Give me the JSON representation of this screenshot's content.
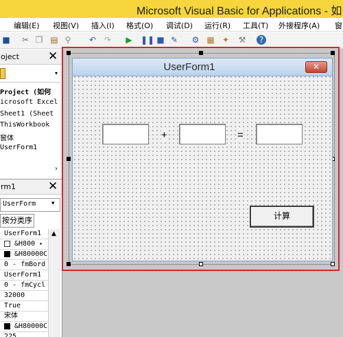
{
  "window": {
    "title": "Microsoft Visual Basic for Applications - 如"
  },
  "menu": [
    "编辑(E)",
    "视图(V)",
    "插入(I)",
    "格式(O)",
    "调试(D)",
    "运行(R)",
    "工具(T)",
    "外接程序(A)",
    "窗"
  ],
  "project_pane": {
    "label": "oject",
    "tree": [
      "Project (如何",
      "icrosoft Excel",
      "Sheet1 (Sheet",
      "ThisWorkbook",
      "窗体",
      "UserForm1"
    ]
  },
  "properties_pane": {
    "label": "rm1",
    "object_select": "UserForm",
    "tab": "按分类序",
    "values": [
      "UserForm1",
      "&H800",
      "&H80000C",
      "0 - fmBord",
      "UserForm1",
      "0 - fmCycl",
      "32000",
      "True",
      "宋体",
      "&H80000C",
      "225"
    ]
  },
  "userform": {
    "caption": "UserForm1",
    "close_glyph": "✕",
    "plus": "+",
    "equals": "=",
    "calc_button": "计算"
  },
  "colors": {
    "highlight_frame": "#d9232a",
    "title_bar": "#f6d63c"
  }
}
